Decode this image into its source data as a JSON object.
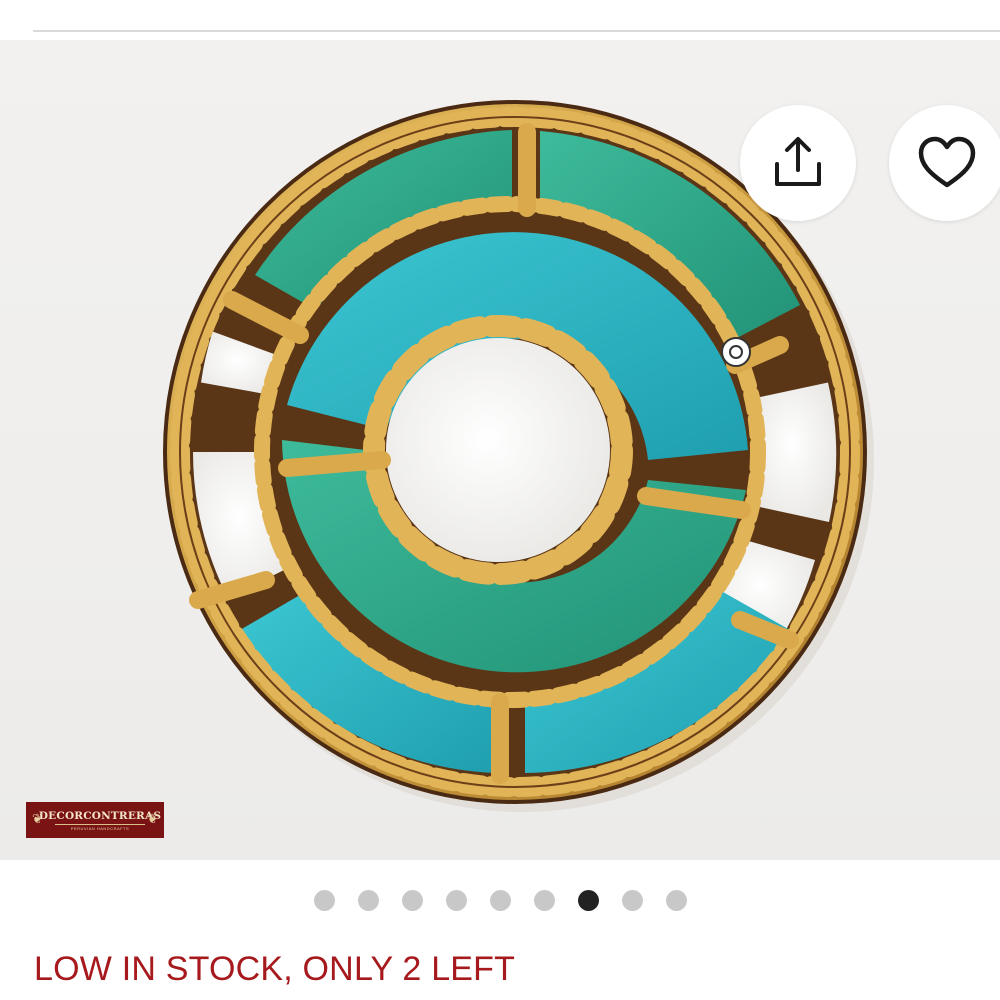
{
  "gallery": {
    "image_alt": "Round wall mirror with turquoise and green glass segments in a gold scalloped frame",
    "brand_logo": {
      "name": "DECORCONTRERAS",
      "tagline": "PERUVIAN HANDCRAFTS"
    },
    "share_icon": "share-icon",
    "favorite_icon": "heart-icon",
    "dots": {
      "count": 9,
      "active_index": 6
    }
  },
  "stock": {
    "message": "LOW IN STOCK, ONLY 2 LEFT",
    "color": "#a6191c"
  },
  "colors": {
    "gold": "#c99a3e",
    "turquoise": "#29b7c4",
    "green": "#2fa98f",
    "mirror": "#f6f6f4"
  }
}
